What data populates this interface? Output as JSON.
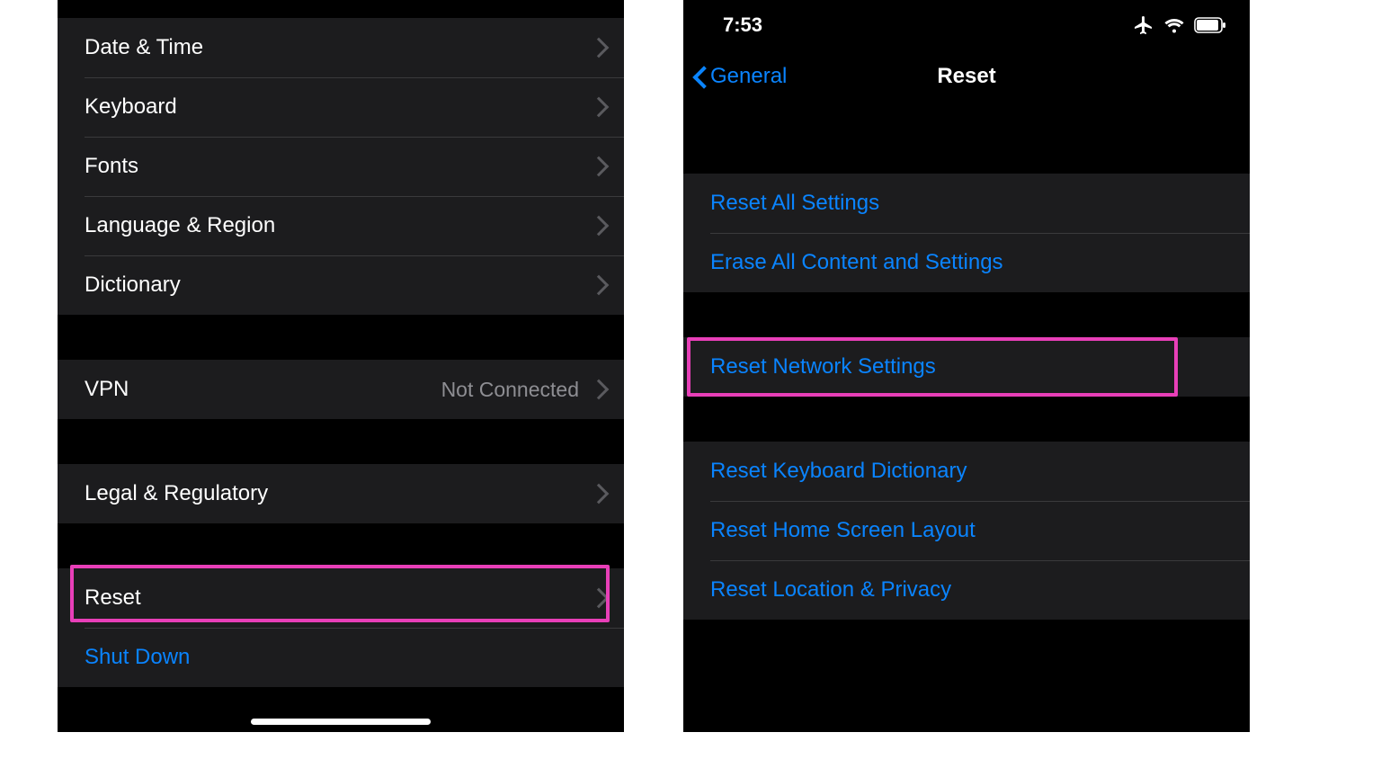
{
  "colors": {
    "accent_blue": "#0a84ff",
    "highlight_pink": "#e83fb8",
    "row_bg": "#1c1c1e",
    "detail_gray": "#8e8e93"
  },
  "left": {
    "rows": {
      "date_time": "Date & Time",
      "keyboard": "Keyboard",
      "fonts": "Fonts",
      "language_region": "Language & Region",
      "dictionary": "Dictionary",
      "vpn": "VPN",
      "vpn_status": "Not Connected",
      "legal": "Legal & Regulatory",
      "reset": "Reset",
      "shutdown": "Shut Down"
    }
  },
  "right": {
    "status": {
      "time": "7:53"
    },
    "nav": {
      "back": "General",
      "title": "Reset"
    },
    "rows": {
      "reset_all": "Reset All Settings",
      "erase_all": "Erase All Content and Settings",
      "reset_network": "Reset Network Settings",
      "reset_keyboard": "Reset Keyboard Dictionary",
      "reset_home": "Reset Home Screen Layout",
      "reset_location": "Reset Location & Privacy"
    }
  }
}
